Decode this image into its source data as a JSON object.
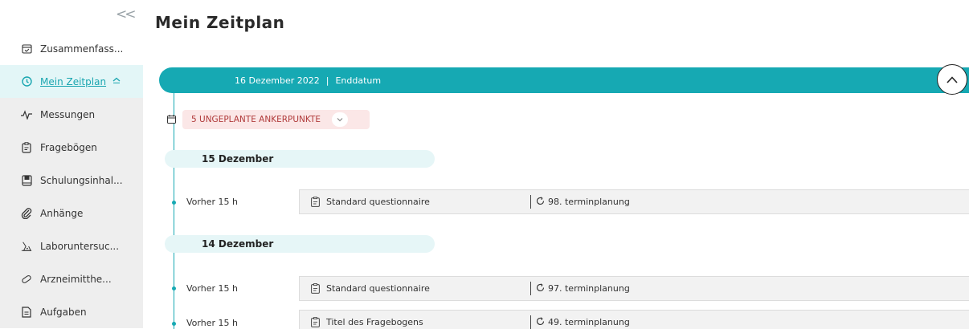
{
  "page": {
    "title": "Mein Zeitplan"
  },
  "sidebar": {
    "collapse_glyph": "<<",
    "items": [
      {
        "label": "Zusammenfass...",
        "icon": "calendar-check-icon"
      },
      {
        "label": "Mein Zeitplan",
        "icon": "clock-icon",
        "chevron": "^"
      },
      {
        "label": "Messungen",
        "icon": "pulse-icon"
      },
      {
        "label": "Fragebögen",
        "icon": "clipboard-icon"
      },
      {
        "label": "Schulungsinhal...",
        "icon": "book-icon"
      },
      {
        "label": "Anhänge",
        "icon": "paperclip-icon"
      },
      {
        "label": "Laboruntersuc...",
        "icon": "flask-icon"
      },
      {
        "label": "Arzneimitthe...",
        "icon": "pill-icon"
      },
      {
        "label": "Aufgaben",
        "icon": "document-icon"
      }
    ]
  },
  "timeline": {
    "end_date": "16 Dezember 2022",
    "end_separator": "|",
    "end_label": "Enddatum",
    "anchor_label": "5 UNGEPLANTE ANKERPUNKTE",
    "days": [
      {
        "label": "15 Dezember",
        "entries": [
          {
            "time": "Vorher 15 h",
            "questionnaire": "Standard questionnaire",
            "schedule": "98. terminplanung"
          }
        ]
      },
      {
        "label": "14 Dezember",
        "entries": [
          {
            "time": "Vorher 15 h",
            "questionnaire": "Standard questionnaire",
            "schedule": "97. terminplanung"
          },
          {
            "time": "Vorher 15 h",
            "questionnaire": "Titel des Fragebogens",
            "schedule": "49. terminplanung"
          }
        ]
      }
    ]
  },
  "colors": {
    "accent": "#16a9b3",
    "anchor_bg": "#fbe7e7",
    "anchor_text": "#b03a3a",
    "day_bg": "#e6f6f7"
  }
}
